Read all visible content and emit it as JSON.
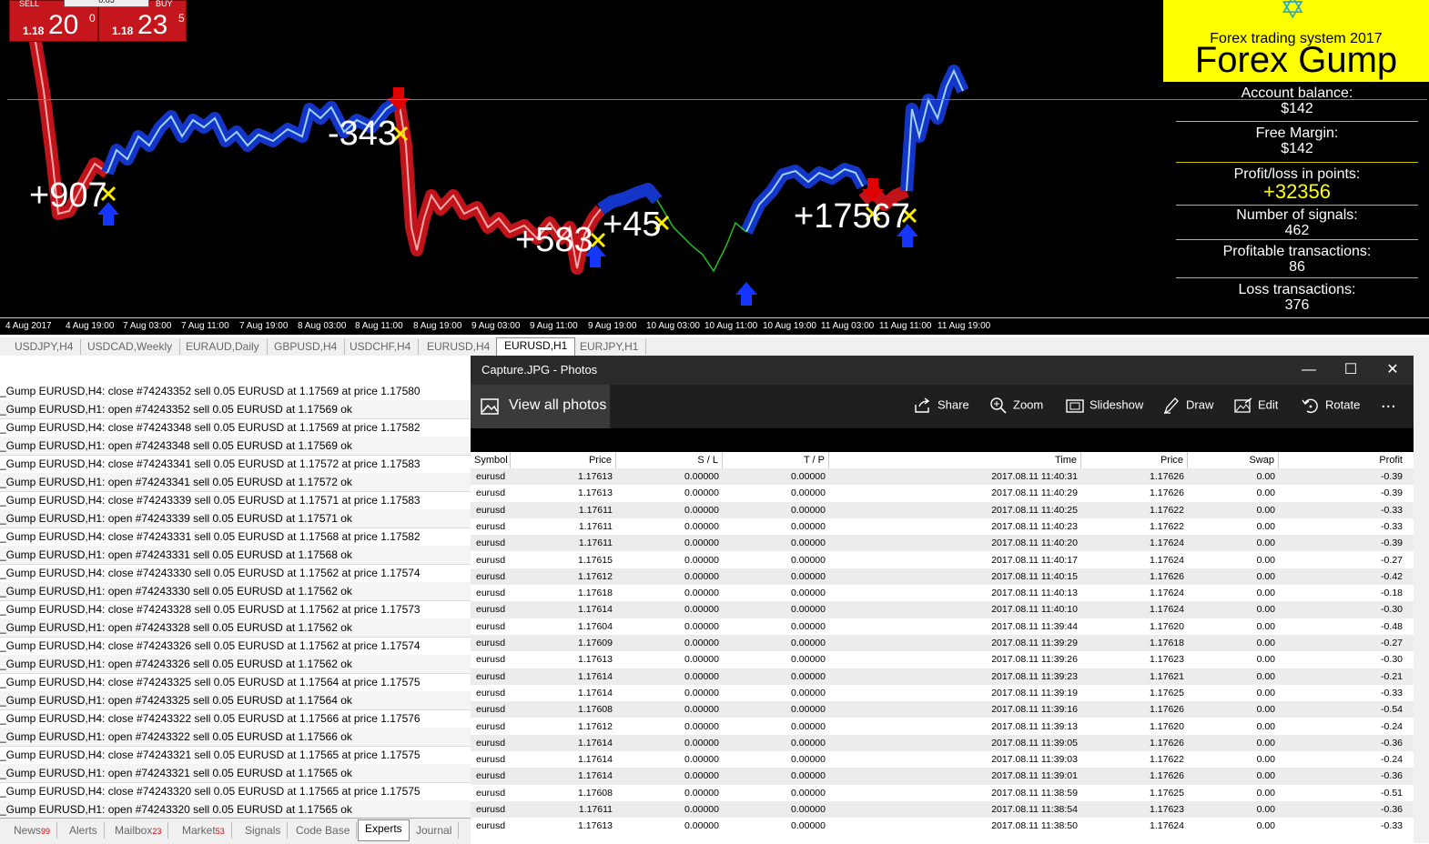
{
  "trade_panel": {
    "sell_label": "SELL",
    "buy_label": "BUY",
    "lot": "0.05",
    "sell_prefix": "1.18",
    "sell_big": "20",
    "sell_sup": "0",
    "buy_prefix": "1.18",
    "buy_big": "23",
    "buy_sup": "5"
  },
  "chart_markers": [
    "+907",
    "-343",
    "+583",
    "+45",
    "+17567"
  ],
  "info_box": {
    "subtitle": "Forex trading system 2017",
    "title": "Forex Gump",
    "stats": [
      {
        "label": "Account balance:",
        "value": "$142"
      },
      {
        "label": "Free Margin:",
        "value": "$142"
      },
      {
        "label": "Profit/loss in points:",
        "value": "+32356"
      },
      {
        "label": "Number of signals:",
        "value": "462"
      },
      {
        "label": "Profitable transactions:",
        "value": "86"
      },
      {
        "label": "Loss transactions:",
        "value": "376"
      }
    ]
  },
  "time_axis": [
    "4 Aug 2017",
    "4 Aug 19:00",
    "7 Aug 03:00",
    "7 Aug 11:00",
    "7 Aug 19:00",
    "8 Aug 03:00",
    "8 Aug 11:00",
    "8 Aug 19:00",
    "9 Aug 03:00",
    "9 Aug 11:00",
    "9 Aug 19:00",
    "10 Aug 03:00",
    "10 Aug 11:00",
    "10 Aug 19:00",
    "11 Aug 03:00",
    "11 Aug 11:00",
    "11 Aug 19:00"
  ],
  "chart_tabs": [
    "USDJPY,H4",
    "USDCAD,Weekly",
    "EURAUD,Daily",
    "GBPUSD,H4",
    "USDCHF,H4",
    "EURUSD,H4",
    "EURUSD,H1",
    "EURJPY,H1"
  ],
  "log_lines": [
    "_Gump EURUSD,H4: close #74243352 sell 0.05 EURUSD at 1.17569 at price 1.17580",
    "_Gump EURUSD,H1: open #74243352 sell 0.05 EURUSD at 1.17569 ok",
    "_Gump EURUSD,H4: close #74243348 sell 0.05 EURUSD at 1.17569 at price 1.17582",
    "_Gump EURUSD,H1: open #74243348 sell 0.05 EURUSD at 1.17569 ok",
    "_Gump EURUSD,H4: close #74243341 sell 0.05 EURUSD at 1.17572 at price 1.17583",
    "_Gump EURUSD,H1: open #74243341 sell 0.05 EURUSD at 1.17572 ok",
    "_Gump EURUSD,H4: close #74243339 sell 0.05 EURUSD at 1.17571 at price 1.17583",
    "_Gump EURUSD,H1: open #74243339 sell 0.05 EURUSD at 1.17571 ok",
    "_Gump EURUSD,H4: close #74243331 sell 0.05 EURUSD at 1.17568 at price 1.17582",
    "_Gump EURUSD,H1: open #74243331 sell 0.05 EURUSD at 1.17568 ok",
    "_Gump EURUSD,H4: close #74243330 sell 0.05 EURUSD at 1.17562 at price 1.17574",
    "_Gump EURUSD,H1: open #74243330 sell 0.05 EURUSD at 1.17562 ok",
    "_Gump EURUSD,H4: close #74243328 sell 0.05 EURUSD at 1.17562 at price 1.17573",
    "_Gump EURUSD,H1: open #74243328 sell 0.05 EURUSD at 1.17562 ok",
    "_Gump EURUSD,H4: close #74243326 sell 0.05 EURUSD at 1.17562 at price 1.17574",
    "_Gump EURUSD,H1: open #74243326 sell 0.05 EURUSD at 1.17562 ok",
    "_Gump EURUSD,H4: close #74243325 sell 0.05 EURUSD at 1.17564 at price 1.17575",
    "_Gump EURUSD,H1: open #74243325 sell 0.05 EURUSD at 1.17564 ok",
    "_Gump EURUSD,H4: close #74243322 sell 0.05 EURUSD at 1.17566 at price 1.17576",
    "_Gump EURUSD,H1: open #74243322 sell 0.05 EURUSD at 1.17566 ok",
    "_Gump EURUSD,H4: close #74243321 sell 0.05 EURUSD at 1.17565 at price 1.17575",
    "_Gump EURUSD,H1: open #74243321 sell 0.05 EURUSD at 1.17565 ok",
    "_Gump EURUSD,H4: close #74243320 sell 0.05 EURUSD at 1.17565 at price 1.17575",
    "_Gump EURUSD,H1: open #74243320 sell 0.05 EURUSD at 1.17565 ok"
  ],
  "bottom_tabs": [
    {
      "label": "News",
      "badge": "99"
    },
    {
      "label": "Alerts",
      "badge": ""
    },
    {
      "label": "Mailbox",
      "badge": "23"
    },
    {
      "label": "Market",
      "badge": "53"
    },
    {
      "label": "Signals",
      "badge": ""
    },
    {
      "label": "Code Base",
      "badge": ""
    },
    {
      "label": "Experts",
      "badge": ""
    },
    {
      "label": "Journal",
      "badge": ""
    }
  ],
  "photos": {
    "window_title": "Capture.JPG - Photos",
    "view_all": "View all photos",
    "tools": [
      "Share",
      "Zoom",
      "Slideshow",
      "Draw",
      "Edit",
      "Rotate"
    ],
    "more": "...",
    "columns": [
      "Symbol",
      "Price",
      "S / L",
      "T / P",
      "Time",
      "Price",
      "Swap",
      "Profit"
    ],
    "rows": [
      [
        "eurusd",
        "1.17613",
        "0.00000",
        "0.00000",
        "2017.08.11 11:40:31",
        "1.17626",
        "0.00",
        "-0.39"
      ],
      [
        "eurusd",
        "1.17613",
        "0.00000",
        "0.00000",
        "2017.08.11 11:40:29",
        "1.17626",
        "0.00",
        "-0.39"
      ],
      [
        "eurusd",
        "1.17611",
        "0.00000",
        "0.00000",
        "2017.08.11 11:40:25",
        "1.17622",
        "0.00",
        "-0.33"
      ],
      [
        "eurusd",
        "1.17611",
        "0.00000",
        "0.00000",
        "2017.08.11 11:40:23",
        "1.17622",
        "0.00",
        "-0.33"
      ],
      [
        "eurusd",
        "1.17611",
        "0.00000",
        "0.00000",
        "2017.08.11 11:40:20",
        "1.17624",
        "0.00",
        "-0.39"
      ],
      [
        "eurusd",
        "1.17615",
        "0.00000",
        "0.00000",
        "2017.08.11 11:40:17",
        "1.17624",
        "0.00",
        "-0.27"
      ],
      [
        "eurusd",
        "1.17612",
        "0.00000",
        "0.00000",
        "2017.08.11 11:40:15",
        "1.17626",
        "0.00",
        "-0.42"
      ],
      [
        "eurusd",
        "1.17618",
        "0.00000",
        "0.00000",
        "2017.08.11 11:40:13",
        "1.17624",
        "0.00",
        "-0.18"
      ],
      [
        "eurusd",
        "1.17614",
        "0.00000",
        "0.00000",
        "2017.08.11 11:40:10",
        "1.17624",
        "0.00",
        "-0.30"
      ],
      [
        "eurusd",
        "1.17604",
        "0.00000",
        "0.00000",
        "2017.08.11 11:39:44",
        "1.17620",
        "0.00",
        "-0.48"
      ],
      [
        "eurusd",
        "1.17609",
        "0.00000",
        "0.00000",
        "2017.08.11 11:39:29",
        "1.17618",
        "0.00",
        "-0.27"
      ],
      [
        "eurusd",
        "1.17613",
        "0.00000",
        "0.00000",
        "2017.08.11 11:39:26",
        "1.17623",
        "0.00",
        "-0.30"
      ],
      [
        "eurusd",
        "1.17614",
        "0.00000",
        "0.00000",
        "2017.08.11 11:39:23",
        "1.17621",
        "0.00",
        "-0.21"
      ],
      [
        "eurusd",
        "1.17614",
        "0.00000",
        "0.00000",
        "2017.08.11 11:39:19",
        "1.17625",
        "0.00",
        "-0.33"
      ],
      [
        "eurusd",
        "1.17608",
        "0.00000",
        "0.00000",
        "2017.08.11 11:39:16",
        "1.17626",
        "0.00",
        "-0.54"
      ],
      [
        "eurusd",
        "1.17612",
        "0.00000",
        "0.00000",
        "2017.08.11 11:39:13",
        "1.17620",
        "0.00",
        "-0.24"
      ],
      [
        "eurusd",
        "1.17614",
        "0.00000",
        "0.00000",
        "2017.08.11 11:39:05",
        "1.17626",
        "0.00",
        "-0.36"
      ],
      [
        "eurusd",
        "1.17614",
        "0.00000",
        "0.00000",
        "2017.08.11 11:39:03",
        "1.17622",
        "0.00",
        "-0.24"
      ],
      [
        "eurusd",
        "1.17614",
        "0.00000",
        "0.00000",
        "2017.08.11 11:39:01",
        "1.17626",
        "0.00",
        "-0.36"
      ],
      [
        "eurusd",
        "1.17608",
        "0.00000",
        "0.00000",
        "2017.08.11 11:38:59",
        "1.17625",
        "0.00",
        "-0.51"
      ],
      [
        "eurusd",
        "1.17611",
        "0.00000",
        "0.00000",
        "2017.08.11 11:38:54",
        "1.17623",
        "0.00",
        "-0.36"
      ],
      [
        "eurusd",
        "1.17613",
        "0.00000",
        "0.00000",
        "2017.08.11 11:38:50",
        "1.17624",
        "0.00",
        "-0.33"
      ]
    ]
  },
  "colors": {
    "chart_bg": "#000000",
    "sell_trend": "#c0141a",
    "buy_trend": "#1436c8",
    "info_yellow": "#ffff00",
    "trade_red": "#c4161c"
  }
}
